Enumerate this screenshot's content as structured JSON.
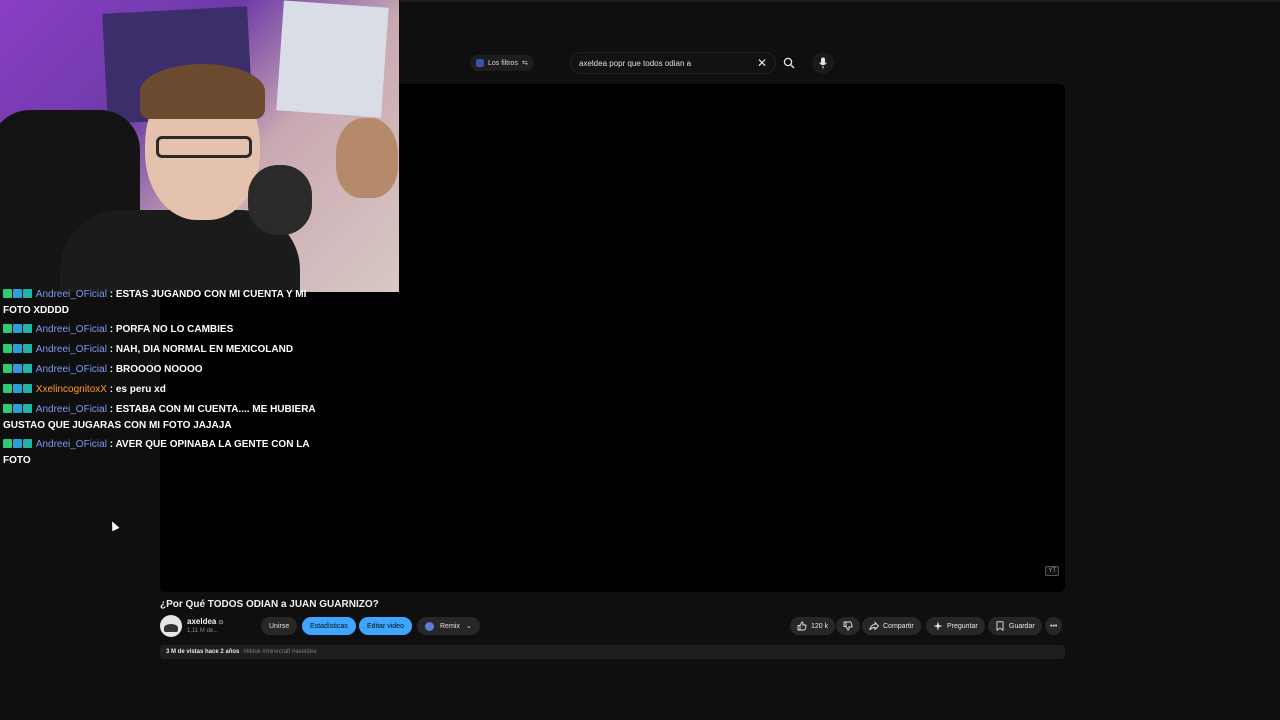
{
  "youtube": {
    "filters_label": "Los filtros",
    "search_query": "axeldea popr que todos odian a",
    "video_title": "¿Por Qué TODOS ODIAN a JUAN GUARNIZO?",
    "channel_name": "axeldea",
    "channel_subs": "1,11 M de...",
    "buttons": {
      "join": "Unirse",
      "stats": "Estadísticas",
      "edit": "Editar video",
      "remix": "Remix"
    },
    "actions": {
      "likes": "120 k",
      "share": "Compartir",
      "ask": "Preguntar",
      "save": "Guardar"
    },
    "description": {
      "views_date": "3 M de vistas  hace 2 años",
      "tags": "#tiktok #minecraft #axeldea"
    },
    "player_badge": "YT"
  },
  "chat": {
    "messages": [
      {
        "user": "Andreei_OFicial",
        "user_color": "#7b9cf4",
        "text": ": ESTAS JUGANDO CON MI CUENTA Y MI FOTO XDDDD"
      },
      {
        "user": "Andreei_OFicial",
        "user_color": "#7b9cf4",
        "text": ": PORFA NO LO CAMBIES"
      },
      {
        "user": "Andreei_OFicial",
        "user_color": "#7b9cf4",
        "text": ": NAH, DIA NORMAL EN MEXICOLAND"
      },
      {
        "user": "Andreei_OFicial",
        "user_color": "#7b9cf4",
        "text": ": BROOOO NOOOO"
      },
      {
        "user": "XxelincognitoxX",
        "user_color": "#ff9e2c",
        "text": ": es peru xd"
      },
      {
        "user": "Andreei_OFicial",
        "user_color": "#7b9cf4",
        "text": ": ESTABA CON MI CUENTA.... ME HUBIERA GUSTAO QUE JUGARAS CON MI FOTO JAJAJA"
      },
      {
        "user": "Andreei_OFicial",
        "user_color": "#7b9cf4",
        "text": ": AVER QUE OPINABA LA GENTE CON LA FOTO"
      }
    ]
  }
}
